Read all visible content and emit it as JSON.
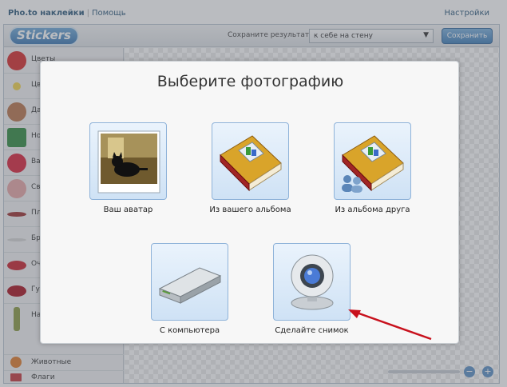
{
  "topbar": {
    "app_link": "Pho.to наклейки",
    "separator": "|",
    "help_link": "Помощь",
    "settings_link": "Настройки"
  },
  "toolbar": {
    "logo_text": "Stickers",
    "save_result_label": "Сохраните результат",
    "save_target_selected": "к себе на стену",
    "save_button": "Сохранить"
  },
  "sidebar": {
    "items": [
      {
        "label": "Цветы",
        "color": "#d62a2a"
      },
      {
        "label": "Цвет",
        "color": "#f2d24a"
      },
      {
        "label": "Да",
        "color": "#b8744a"
      },
      {
        "label": "Но",
        "color": "#2f8a3e"
      },
      {
        "label": "Ва",
        "color": "#d9223a"
      },
      {
        "label": "Св",
        "color": "#e7a6a6"
      },
      {
        "label": "Пл",
        "color": "#9b3030"
      },
      {
        "label": "Бр",
        "color": "#d4d4d4"
      },
      {
        "label": "Оч",
        "color": "#c8202b"
      },
      {
        "label": "Гу",
        "color": "#a8101e"
      },
      {
        "label": "На",
        "color": "#8a9a42"
      },
      {
        "label": "Животные",
        "color": "#e07b2a"
      },
      {
        "label": "Флаги",
        "color": "#c4363b"
      }
    ]
  },
  "dialog": {
    "title": "Выберите фотографию",
    "options": [
      {
        "label": "Ваш аватар",
        "icon": "cat-photo-icon"
      },
      {
        "label": "Из вашего альбома",
        "icon": "photo-album-icon"
      },
      {
        "label": "Из альбома друга",
        "icon": "friend-album-icon"
      },
      {
        "label": "С компьютера",
        "icon": "hard-drive-icon"
      },
      {
        "label": "Сделайте снимок",
        "icon": "webcam-icon"
      }
    ]
  },
  "colors": {
    "accent": "#3e7db8",
    "link": "#2b587a",
    "arrow": "#c8101c"
  }
}
